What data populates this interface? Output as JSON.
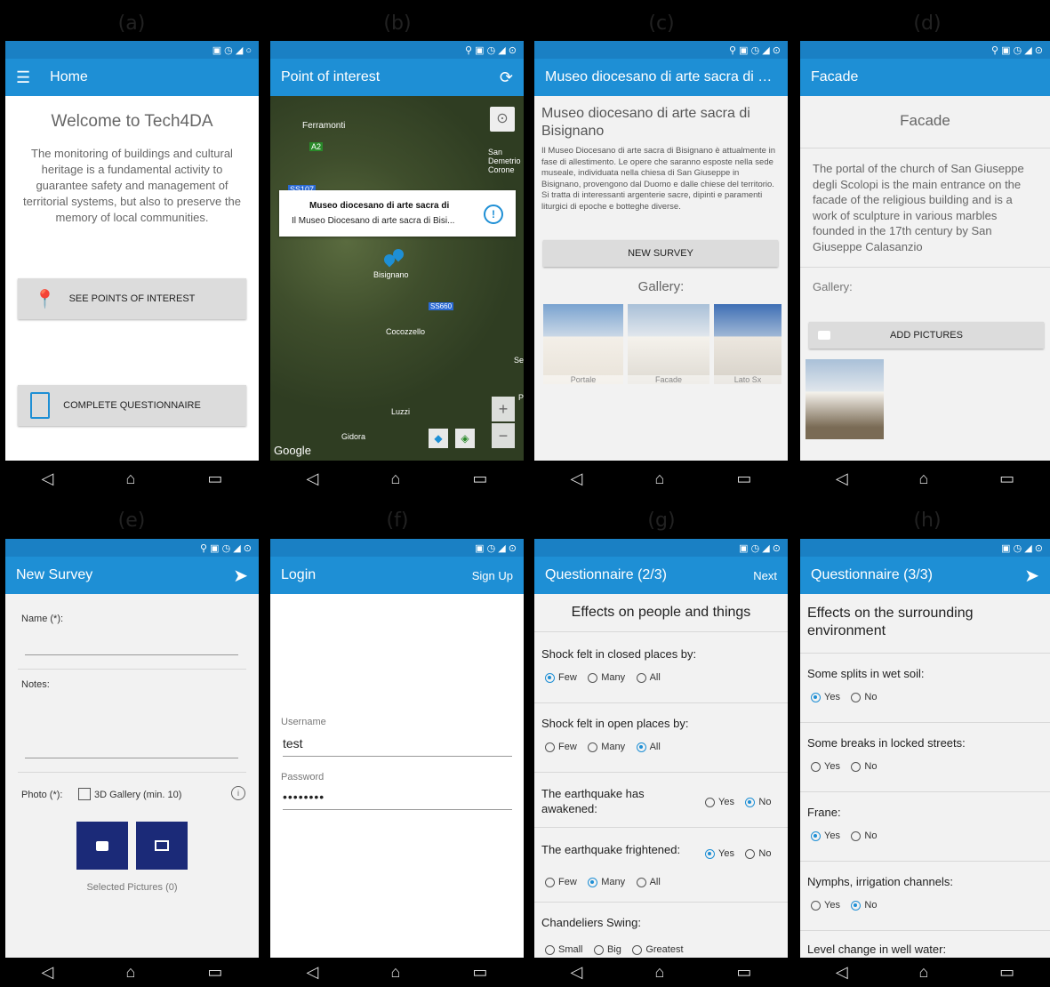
{
  "labels": [
    "(a)",
    "(b)",
    "(c)",
    "(d)",
    "(e)",
    "(f)",
    "(g)",
    "(h)"
  ],
  "nav": {
    "back": "◁",
    "home": "⌂",
    "recent": "▭"
  },
  "a": {
    "title": "Home",
    "welcome": "Welcome to Tech4DA",
    "intro": "The monitoring of buildings and cultural heritage is a fundamental activity to guarantee safety and management of territorial systems, but also to preserve the memory of local communities.",
    "btn1": "SEE POINTS OF INTEREST",
    "btn2": "COMPLETE QUESTIONNAIRE"
  },
  "b": {
    "title": "Point of interest",
    "popup_title": "Museo diocesano di arte sacra di",
    "popup_sub": "Il Museo Diocesano di arte sacra di Bisi...",
    "places": [
      "Ferramonti",
      "A2",
      "SS107",
      "San Demetrio Corone",
      "Bisignano",
      "SS660",
      "Cocozzello",
      "Luzzi",
      "Gidora",
      "Se",
      "P"
    ],
    "google": "Google"
  },
  "c": {
    "title": "Museo diocesano di arte sacra di Bis...",
    "heading": "Museo diocesano di arte sacra di Bisignano",
    "desc": "Il Museo Diocesano di arte sacra di Bisignano è attualmente in fase di allestimento. Le opere che saranno esposte nella sede museale, individuata nella chiesa di San Giuseppe in Bisignano, provengono dal Duomo e dalle chiese del territorio. Si tratta di interessanti argenterie sacre, dipinti e paramenti liturgici di epoche e botteghe diverse.",
    "btn": "NEW SURVEY",
    "gallery": "Gallery:",
    "thumbs": [
      "Portale",
      "Facade",
      "Lato Sx"
    ]
  },
  "d": {
    "title": "Facade",
    "heading": "Facade",
    "desc": "The portal of the church of San Giuseppe degli Scolopi is the main entrance on the facade of the religious building and is a work of sculpture in various marbles founded in the 17th century by San Giuseppe Calasanzio",
    "gallery": "Gallery:",
    "btn": "ADD PICTURES"
  },
  "e": {
    "title": "New Survey",
    "name": "Name (*):",
    "notes": "Notes:",
    "photo": "Photo (*):",
    "gallery3d": "3D Gallery (min. 10)",
    "selected": "Selected Pictures (0)"
  },
  "f": {
    "title": "Login",
    "action": "Sign Up",
    "username_label": "Username",
    "username": "test",
    "password_label": "Password",
    "password": "••••••••"
  },
  "g": {
    "title": "Questionnaire (2/3)",
    "action": "Next",
    "heading": "Effects on people and things",
    "q1": "Shock felt in closed places by:",
    "q2": "Shock felt in open places by:",
    "q3": "The earthquake has awakened:",
    "q4": "The earthquake frightened:",
    "q5": "Chandeliers Swing:",
    "few": "Few",
    "many": "Many",
    "all": "All",
    "yes": "Yes",
    "no": "No",
    "small": "Small",
    "big": "Big",
    "greatest": "Greatest"
  },
  "h": {
    "title": "Questionnaire (3/3)",
    "heading": "Effects on the surrounding environment",
    "q1": "Some splits in wet soil:",
    "q2": "Some breaks in locked streets:",
    "q3": "Frane:",
    "q4": "Nymphs, irrigation channels:",
    "q5": "Level change in well water:",
    "yes": "Yes",
    "no": "No"
  },
  "colors": {
    "primary": "#1e8fd5",
    "dark_button": "#1b2a78"
  }
}
